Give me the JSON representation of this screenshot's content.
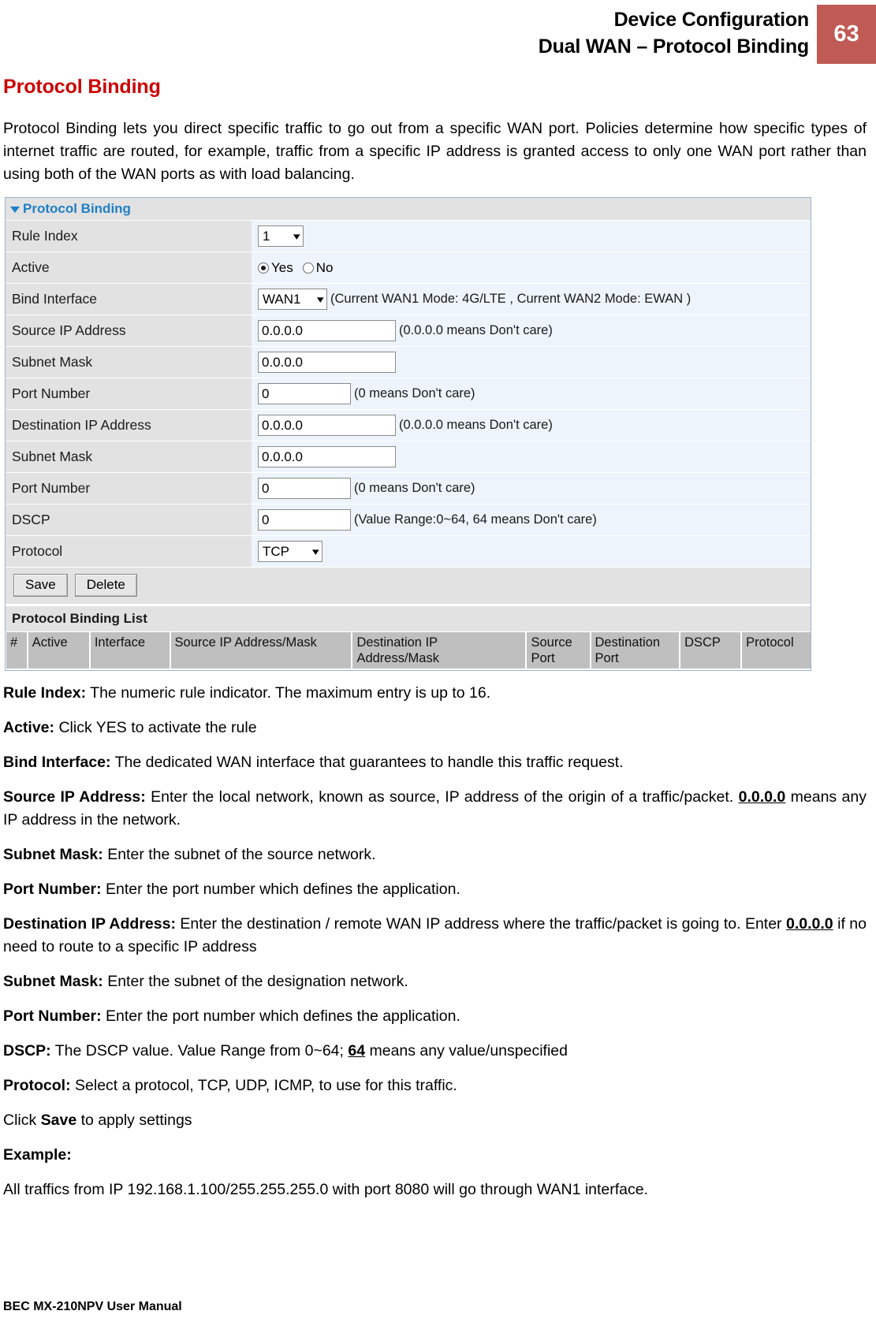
{
  "header": {
    "title_line1": "Device Configuration",
    "title_line2": "Dual WAN – Protocol Binding",
    "page_number": "63",
    "badge_color": "#bf5a55"
  },
  "section": {
    "title": "Protocol Binding",
    "title_color": "#cc0000",
    "intro": "Protocol Binding lets you direct specific traffic to go out from a specific WAN port. Policies determine how specific types of internet traffic are routed, for example, traffic from a specific IP address is granted access to only one WAN port rather than using both of the WAN ports as with load balancing."
  },
  "screenshot": {
    "panel_title": "Protocol Binding",
    "rows": {
      "rule_index": {
        "label": "Rule Index",
        "value": "1"
      },
      "active": {
        "label": "Active",
        "yes_label": "Yes",
        "no_label": "No",
        "selected": "Yes"
      },
      "bind_interface": {
        "label": "Bind Interface",
        "value": "WAN1",
        "hint": "(Current WAN1 Mode: 4G/LTE , Current WAN2 Mode: EWAN )"
      },
      "source_ip": {
        "label": "Source IP Address",
        "value": "0.0.0.0",
        "hint": "(0.0.0.0 means Don't care)"
      },
      "source_mask": {
        "label": "Subnet Mask",
        "value": "0.0.0.0",
        "hint": ""
      },
      "source_port": {
        "label": "Port Number",
        "value": "0",
        "hint": "(0 means Don't care)"
      },
      "dest_ip": {
        "label": "Destination IP Address",
        "value": "0.0.0.0",
        "hint": "(0.0.0.0 means Don't care)"
      },
      "dest_mask": {
        "label": "Subnet Mask",
        "value": "0.0.0.0",
        "hint": ""
      },
      "dest_port": {
        "label": "Port Number",
        "value": "0",
        "hint": "(0 means Don't care)"
      },
      "dscp": {
        "label": "DSCP",
        "value": "0",
        "hint": "(Value Range:0~64, 64 means Don't care)"
      },
      "protocol": {
        "label": "Protocol",
        "value": "TCP"
      }
    },
    "buttons": {
      "save": "Save",
      "delete": "Delete"
    },
    "list": {
      "title": "Protocol Binding List",
      "columns": {
        "hash": "#",
        "active": "Active",
        "interface": "Interface",
        "source_ip_mask": "Source IP Address/Mask",
        "dest_ip_mask": "Destination IP Address/Mask",
        "source_port": "Source Port",
        "dest_port": "Destination Port",
        "dscp": "DSCP",
        "protocol": "Protocol"
      }
    }
  },
  "descriptions": {
    "rule_index": {
      "term": "Rule Index:",
      "text": " The numeric rule indicator. The maximum entry is up to 16."
    },
    "active": {
      "term": "Active:",
      "text": " Click YES to activate the rule"
    },
    "bind_interface": {
      "term": "Bind Interface:",
      "text": " The dedicated WAN interface that guarantees to handle this traffic request."
    },
    "source_ip": {
      "term": "Source IP Address:",
      "text_part1": " Enter the local network, known as source, IP address of the origin of a traffic/packet. ",
      "emphasis": "0.0.0.0",
      "text_part2": " means any IP address in the network."
    },
    "source_mask": {
      "term": "Subnet Mask:",
      "text": " Enter the subnet of the source network."
    },
    "source_port": {
      "term": "Port Number:",
      "text": " Enter the port number which defines the application."
    },
    "dest_ip": {
      "term": "Destination IP Address:",
      "text_part1": " Enter the destination / remote WAN IP address where the traffic/packet is going to. Enter ",
      "emphasis": "0.0.0.0",
      "text_part2": " if no need to route to a specific IP address"
    },
    "dest_mask": {
      "term": "Subnet Mask:",
      "text": " Enter the subnet of the designation network."
    },
    "dest_port": {
      "term": "Port Number:",
      "text": " Enter the port number which defines the application."
    },
    "dscp": {
      "term": "DSCP:",
      "text_part1": " The DSCP value. Value Range from 0~64; ",
      "emphasis": "64",
      "text_part2": " means any value/unspecified"
    },
    "protocol": {
      "term": "Protocol:",
      "text": " Select a protocol, TCP, UDP, ICMP, to use for this traffic."
    },
    "click_save": {
      "pre": "Click ",
      "term": "Save",
      "post": " to apply settings"
    },
    "example": {
      "term": "Example:",
      "text": "All traffics from IP 192.168.1.100/255.255.255.0 with port 8080 will go through WAN1 interface."
    }
  },
  "footer": {
    "text": "BEC MX-210NPV User Manual"
  }
}
